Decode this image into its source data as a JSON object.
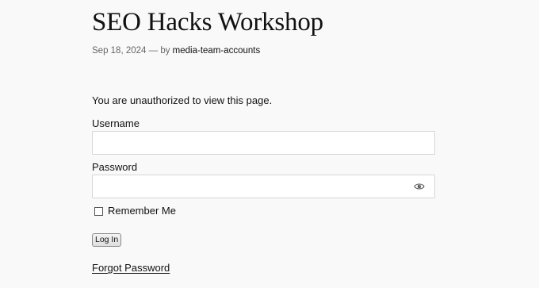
{
  "post": {
    "title": "SEO Hacks Workshop",
    "date": "Sep 18, 2024",
    "separator": "— by",
    "author": "media-team-accounts"
  },
  "login": {
    "notice": "You are unauthorized to view this page.",
    "username_label": "Username",
    "username_value": "",
    "password_label": "Password",
    "password_value": "",
    "remember_label": "Remember Me",
    "remember_checked": false,
    "submit_label": "Log In",
    "forgot_label": "Forgot Password",
    "password_toggle_icon": "eye-icon"
  }
}
